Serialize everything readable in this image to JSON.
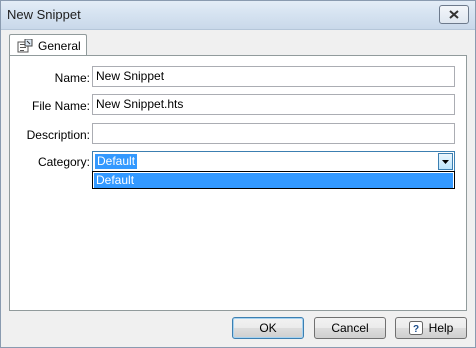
{
  "window": {
    "title": "New Snippet"
  },
  "tabs": [
    {
      "label": "General",
      "icon": "properties-icon"
    }
  ],
  "form": {
    "name_label": "Name:",
    "name_value": "New Snippet",
    "filename_label": "File Name:",
    "filename_value": "New Snippet.hts",
    "description_label": "Description:",
    "description_value": "",
    "category_label": "Category:",
    "category_value": "Default",
    "category_options": [
      "Default"
    ]
  },
  "buttons": {
    "ok": "OK",
    "cancel": "Cancel",
    "help": "Help"
  },
  "colors": {
    "selection": "#3399ff",
    "titlebar": "#d6e3f1",
    "panel": "#ffffff"
  }
}
